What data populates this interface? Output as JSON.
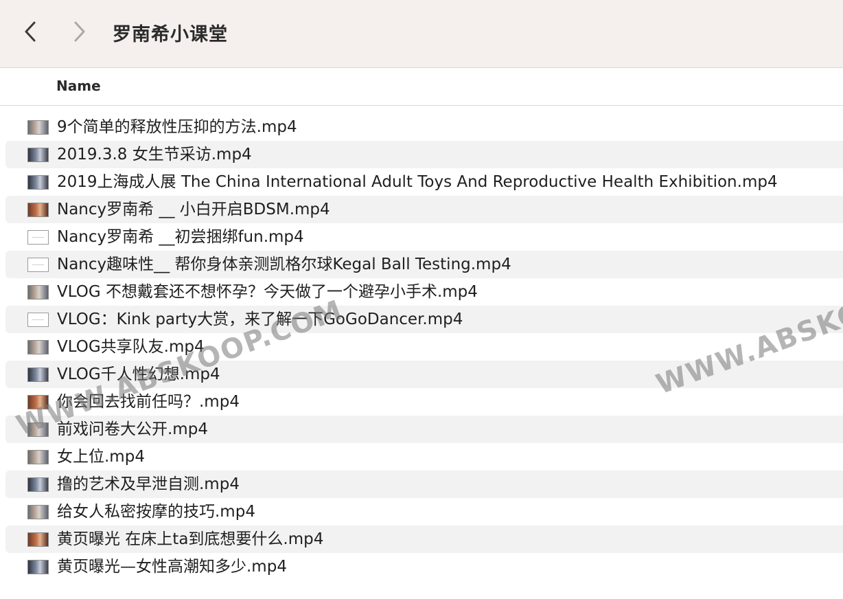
{
  "window": {
    "title": "罗南希小课堂"
  },
  "columns": {
    "name": "Name"
  },
  "files": [
    {
      "name": "9个简单的释放性压抑的方法.mp4",
      "thumb": "photo"
    },
    {
      "name": "2019.3.8 女生节采访.mp4",
      "thumb": "dark"
    },
    {
      "name": "2019上海成人展 The China International Adult Toys And Reproductive Health Exhibition.mp4",
      "thumb": "dark"
    },
    {
      "name": "Nancy罗南希 __ 小白开启BDSM.mp4",
      "thumb": "warm"
    },
    {
      "name": "Nancy罗南希 __初尝捆绑fun.mp4",
      "thumb": "blank"
    },
    {
      "name": "Nancy趣味性__ 帮你身体亲测凯格尔球Kegal Ball Testing.mp4",
      "thumb": "blank"
    },
    {
      "name": "VLOG 不想戴套还不想怀孕？今天做了一个避孕小手术.mp4",
      "thumb": "photo"
    },
    {
      "name": "VLOG：Kink party大赏，来了解一下GoGoDancer.mp4",
      "thumb": "blank"
    },
    {
      "name": "VLOG共享队友.mp4",
      "thumb": "photo"
    },
    {
      "name": "VLOG千人性幻想.mp4",
      "thumb": "dark"
    },
    {
      "name": "你会回去找前任吗？.mp4",
      "thumb": "warm"
    },
    {
      "name": "前戏问卷大公开.mp4",
      "thumb": "photo"
    },
    {
      "name": "女上位.mp4",
      "thumb": "photo"
    },
    {
      "name": "撸的艺术及早泄自测.mp4",
      "thumb": "dark"
    },
    {
      "name": "给女人私密按摩的技巧.mp4",
      "thumb": "photo"
    },
    {
      "name": "黄页曝光 在床上ta到底想要什么.mp4",
      "thumb": "warm"
    },
    {
      "name": "黄页曝光—女性高潮知多少.mp4",
      "thumb": "dark"
    }
  ],
  "watermark": {
    "text": "WWW.ABSKOOP.COM"
  },
  "colors": {
    "titlebar": "#f5f0ed",
    "row_alt": "#f2f2f2"
  },
  "icons": {
    "back": "chevron-left-icon",
    "forward": "chevron-right-icon",
    "file": "video-thumbnail-icon"
  }
}
